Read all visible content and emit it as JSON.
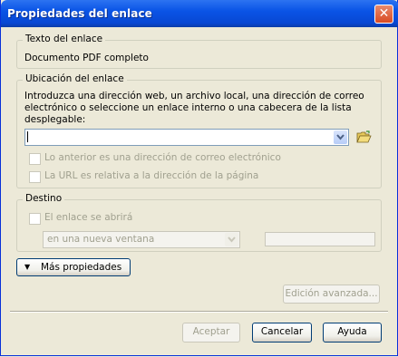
{
  "window": {
    "title": "Propiedades del enlace",
    "close_glyph": "✕"
  },
  "link_text": {
    "legend": "Texto del enlace",
    "value": "Documento PDF completo"
  },
  "location": {
    "legend": "Ubicación del enlace",
    "instructions_1": "Introduzca una dirección web, un archivo local, una dirección de correo",
    "instructions_2": "electrónico o seleccione un enlace interno o una cabecera de la lista",
    "instructions_3": "desplegable:",
    "url_value": "",
    "email_checkbox_label": "Lo anterior es una dirección de correo electrónico",
    "relative_checkbox_label": "La URL es relativa a la dirección de la página",
    "browse_icon": "folder-open-icon"
  },
  "target": {
    "legend": "Destino",
    "checkbox_label": "El enlace se abrirá",
    "select_value": "en una nueva ventana",
    "frame_value": ""
  },
  "buttons": {
    "more_properties": "Más propiedades",
    "more_arrow": "▼",
    "advanced_edit": "Edición avanzada...",
    "accept": "Aceptar",
    "cancel": "Cancelar",
    "help": "Ayuda"
  },
  "colors": {
    "title_bar": "#0a54e6",
    "window_bg": "#ece9d8",
    "close_button": "#d94b23"
  }
}
